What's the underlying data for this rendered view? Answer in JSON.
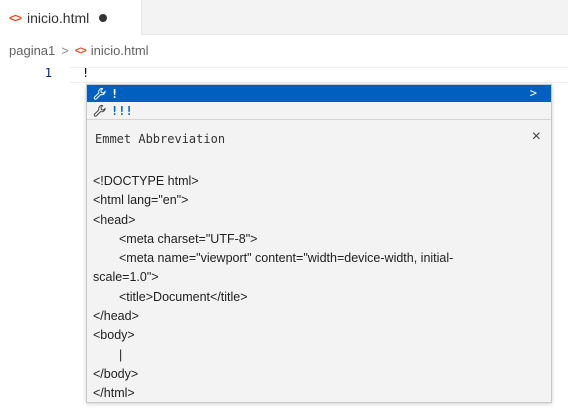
{
  "tab": {
    "icon": "html-file-icon",
    "label": "inicio.html",
    "dirty": true
  },
  "breadcrumb": {
    "folder": "pagina1",
    "separator": ">",
    "file": "inicio.html"
  },
  "editor": {
    "line_number": "1",
    "line_text": "!"
  },
  "suggest": {
    "items": [
      {
        "icon": "wrench-icon",
        "label": "!",
        "selected": true,
        "expand": ">"
      },
      {
        "icon": "wrench-icon",
        "label": "!!!",
        "selected": false
      }
    ],
    "details": {
      "title": "Emmet Abbreviation",
      "close": "×",
      "code": [
        "<!DOCTYPE html>",
        "<html lang=\"en\">",
        "<head>",
        "<meta charset=\"UTF-8\">",
        "<meta name=\"viewport\" content=\"width=device-width, initial-",
        "scale=1.0\">",
        "<title>Document</title>",
        "</head>",
        "<body>",
        "|",
        "</body>",
        "</html>"
      ]
    }
  },
  "colors": {
    "selection": "#0060c0",
    "html_icon": "#e44d26",
    "match_highlight": "#0066bf"
  }
}
